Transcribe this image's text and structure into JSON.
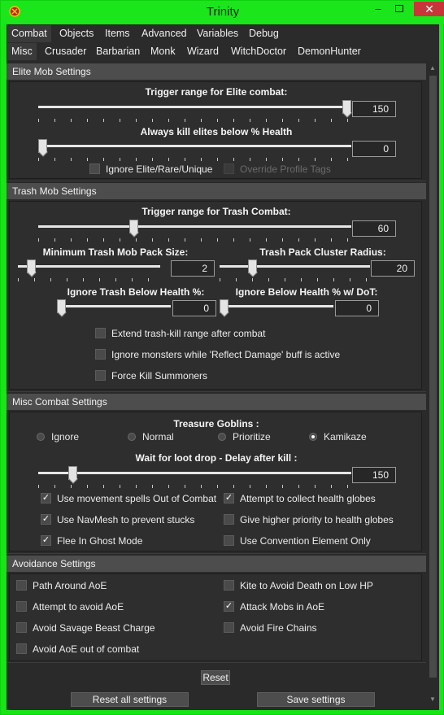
{
  "window": {
    "title": "Trinity"
  },
  "tabs_row1": [
    "Combat",
    "Objects",
    "Items",
    "Advanced",
    "Variables",
    "Debug"
  ],
  "tabs_row2": [
    "Misc",
    "Crusader",
    "Barbarian",
    "Monk",
    "Wizard",
    "WitchDoctor",
    "DemonHunter"
  ],
  "elite": {
    "header": "Elite Mob Settings",
    "trigger_label": "Trigger range for Elite combat:",
    "trigger_value": "150",
    "trigger_fraction": 1.0,
    "kill_label": "Always kill elites below % Health",
    "kill_value": "0",
    "kill_fraction": 0.0,
    "ignore_label": "Ignore Elite/Rare/Unique",
    "override_label": "Override Profile Tags"
  },
  "trash": {
    "header": "Trash Mob Settings",
    "trigger_label": "Trigger range for Trash Combat:",
    "trigger_value": "60",
    "trigger_fraction": 0.3,
    "min_pack_label": "Minimum Trash Mob Pack Size:",
    "min_pack_value": "2",
    "min_pack_fraction": 0.07,
    "cluster_label": "Trash Pack Cluster Radius:",
    "cluster_value": "20",
    "cluster_fraction": 0.2,
    "ignore_health_label": "Ignore Trash Below Health %:",
    "ignore_health_value": "0",
    "ignore_dot_label": "Ignore Below Health % w/ DoT:",
    "ignore_dot_value": "0",
    "extend_label": "Extend trash-kill range after combat",
    "reflect_label": "Ignore monsters while 'Reflect Damage' buff is active",
    "summoners_label": "Force Kill Summoners"
  },
  "misc": {
    "header": "Misc Combat Settings",
    "goblins_label": "Treasure Goblins :",
    "goblin_options": [
      "Ignore",
      "Normal",
      "Prioritize",
      "Kamikaze"
    ],
    "goblin_selected": "Kamikaze",
    "loot_label": "Wait for loot drop - Delay after kill :",
    "loot_value": "150",
    "loot_fraction": 0.1,
    "movement_label": "Use movement spells Out of Combat",
    "globes_label": "Attempt to collect health globes",
    "navmesh_label": "Use NavMesh to prevent stucks",
    "priority_label": "Give higher priority to health globes",
    "ghost_label": "Flee In Ghost Mode",
    "convention_label": "Use Convention Element Only"
  },
  "avoid": {
    "header": "Avoidance Settings",
    "path_label": "Path Around AoE",
    "kite_label": "Kite to Avoid Death on Low HP",
    "attempt_label": "Attempt to avoid AoE",
    "attack_label": "Attack Mobs in AoE",
    "savage_label": "Avoid Savage Beast Charge",
    "firechains_label": "Avoid Fire Chains",
    "outofcombat_label": "Avoid AoE out of combat"
  },
  "buttons": {
    "reset": "Reset",
    "reset_all": "Reset all settings",
    "save": "Save settings"
  },
  "checkmark": "✓",
  "colors": {
    "window_frame": "#15e615",
    "close_button": "#c7373a",
    "panel_bg": "#2e2e2e",
    "header_bg": "#4d4d4d"
  }
}
